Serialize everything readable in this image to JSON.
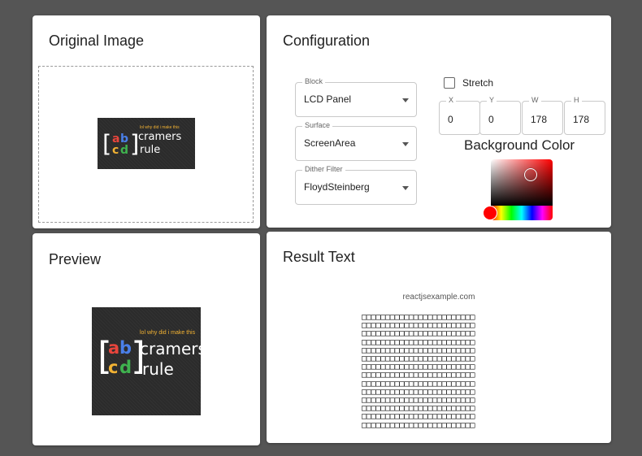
{
  "original": {
    "title": "Original Image"
  },
  "configuration": {
    "title": "Configuration",
    "block": {
      "label": "Block",
      "value": "LCD Panel"
    },
    "surface": {
      "label": "Surface",
      "value": "ScreenArea"
    },
    "dither": {
      "label": "Dither Filter",
      "value": "FloydSteinberg"
    },
    "stretch": {
      "label": "Stretch",
      "checked": false
    },
    "x": {
      "label": "X",
      "value": "0"
    },
    "y": {
      "label": "Y",
      "value": "0"
    },
    "w": {
      "label": "W",
      "value": "178"
    },
    "h": {
      "label": "H",
      "value": "178"
    },
    "background_color": {
      "label": "Background Color",
      "hue": "#ff0000",
      "selected": "#1a1a1a"
    }
  },
  "preview": {
    "title": "Preview"
  },
  "result": {
    "title": "Result Text",
    "watermark": "reactjsexample.com",
    "glyph": "□",
    "rows": 14,
    "cols": 24
  },
  "logo": {
    "tagline": "lol why did i make this",
    "letters": [
      "a",
      "b",
      "c",
      "d"
    ],
    "letter_colors": [
      "#e8453c",
      "#4a7fe8",
      "#f2b233",
      "#3fb34f"
    ],
    "word1": "cramers",
    "word2": "rule",
    "bracket_left": "[",
    "bracket_right": "]"
  }
}
